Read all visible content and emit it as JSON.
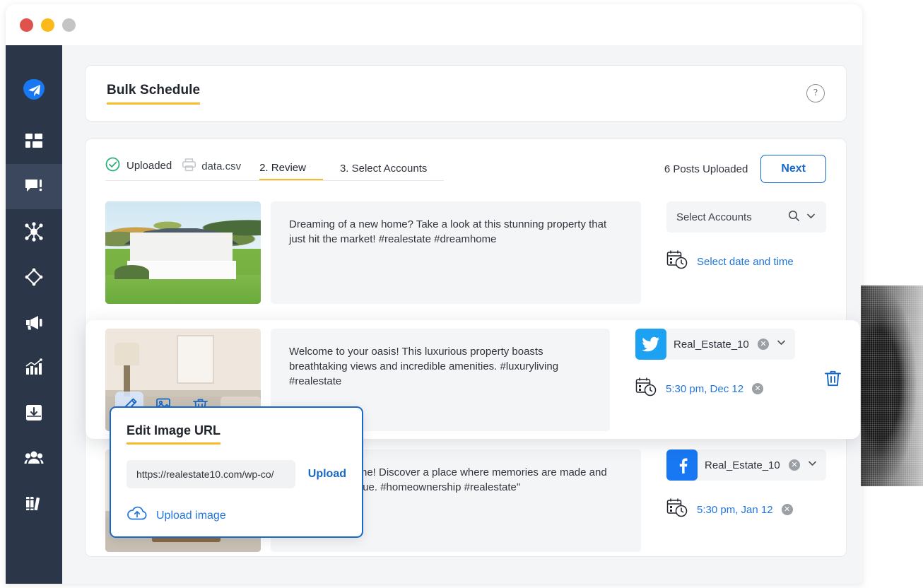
{
  "window": {
    "traffic_lights": [
      {
        "name": "close",
        "color": "#e0524c"
      },
      {
        "name": "minimize",
        "color": "#fbb91b"
      },
      {
        "name": "maximize",
        "color": "#c4c4c4"
      }
    ]
  },
  "sidebar": {
    "items": [
      {
        "icon": "paper-plane-logo",
        "label": "",
        "active": false
      },
      {
        "icon": "dashboard-grid-icon",
        "label": "",
        "active": false
      },
      {
        "icon": "compose-post-icon",
        "label": "",
        "active": true
      },
      {
        "icon": "network-nodes-icon",
        "label": "",
        "active": false
      },
      {
        "icon": "target-diamond-icon",
        "label": "",
        "active": false
      },
      {
        "icon": "megaphone-icon",
        "label": "",
        "active": false
      },
      {
        "icon": "analytics-chart-icon",
        "label": "",
        "active": false
      },
      {
        "icon": "inbox-download-icon",
        "label": "",
        "active": false
      },
      {
        "icon": "team-users-icon",
        "label": "",
        "active": false
      },
      {
        "icon": "library-books-icon",
        "label": "",
        "active": false
      }
    ]
  },
  "header": {
    "title": "Bulk Schedule",
    "help_icon": "question-mark-icon",
    "accent_color": "#f7bc2e"
  },
  "steps": {
    "uploaded_label": "Uploaded",
    "uploaded_icon": "check-circle-icon",
    "file_icon": "printer-icon",
    "file_name": "data.csv",
    "review_label": "2. Review",
    "select_accounts_label": "3. Select Accounts",
    "posts_uploaded": "6 Posts Uploaded",
    "next_label": "Next"
  },
  "posts": [
    {
      "image": "house-exterior-photo",
      "caption": "Dreaming of a new home? Take a look at this stunning property that just hit the market! #realestate #dreamhome",
      "account_placeholder": "Select Accounts",
      "account_name": "",
      "account_network": "",
      "search_icon": "search-icon",
      "chevron_icon": "chevron-down-icon",
      "calendar_icon": "calendar-clock-icon",
      "datetime": "Select date and time"
    },
    {
      "image": "interior-living-room-photo",
      "caption": "Welcome to your oasis! This luxurious property boasts breathtaking views and incredible amenities. #luxuryliving #realestate",
      "account_name": "Real_Estate_10",
      "account_network": "twitter",
      "account_color": "#1da1f2",
      "chevron_icon": "chevron-down-icon",
      "remove_icon": "remove-circle-icon",
      "calendar_icon": "calendar-clock-icon",
      "datetime": "5:30 pm, Dec 12",
      "delete_icon": "trash-icon",
      "tools": [
        "edit-pencil-icon",
        "edit-image-icon",
        "delete-image-icon"
      ]
    },
    {
      "image": "interior-room-photo",
      "caption": "Your dream home! Discover a place where memories are made and dreams come true. #homeownership #realestate\"",
      "account_name": "Real_Estate_10",
      "account_network": "facebook",
      "account_color": "#1877f2",
      "chevron_icon": "chevron-down-icon",
      "remove_icon": "remove-circle-icon",
      "calendar_icon": "calendar-clock-icon",
      "datetime": "5:30 pm, Jan 12"
    }
  ],
  "popup": {
    "title": "Edit Image URL",
    "url_value": "https://realestate10.com/wp-co/",
    "url_placeholder": "https://",
    "upload_label": "Upload",
    "upload_image_label": "Upload image",
    "cloud_icon": "cloud-upload-icon",
    "border_color": "#1668c9",
    "accent_color": "#f7bc2e"
  }
}
